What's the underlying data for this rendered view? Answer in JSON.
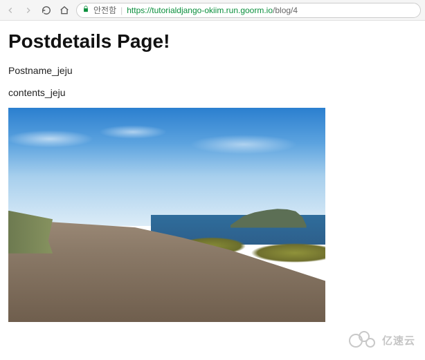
{
  "browser": {
    "insecure_label": "안전함",
    "url_host": "https://tutorialdjango-okiim.run.goorm.io",
    "url_path": "/blog/4"
  },
  "page": {
    "title": "Postdetails Page!",
    "postname": "Postname_jeju",
    "contents": "contents_jeju"
  },
  "watermark": {
    "text": "亿速云"
  }
}
